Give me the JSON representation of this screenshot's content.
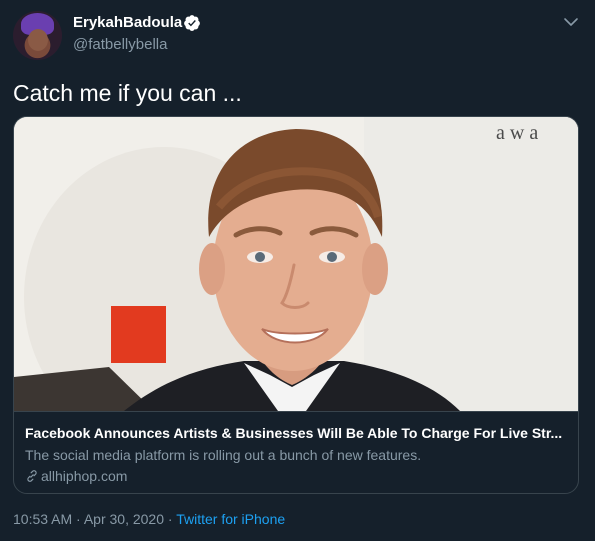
{
  "user": {
    "display_name": "ErykahBadoula",
    "handle": "@fatbellybella",
    "verified": true
  },
  "tweet": {
    "text": "Catch me if you can ..."
  },
  "link_card": {
    "image_text": "a w a",
    "title": "Facebook Announces Artists & Businesses Will Be Able To Charge For Live Str...",
    "description": "The social media platform is rolling out a bunch of new features.",
    "domain": "allhiphop.com"
  },
  "meta": {
    "time": "10:53 AM",
    "separator1": " · ",
    "date": "Apr 30, 2020",
    "separator2": " · ",
    "source": "Twitter for iPhone"
  },
  "colors": {
    "background": "#15202b",
    "border": "#38444d",
    "secondary_text": "#8899a6",
    "accent": "#1da1f2"
  }
}
